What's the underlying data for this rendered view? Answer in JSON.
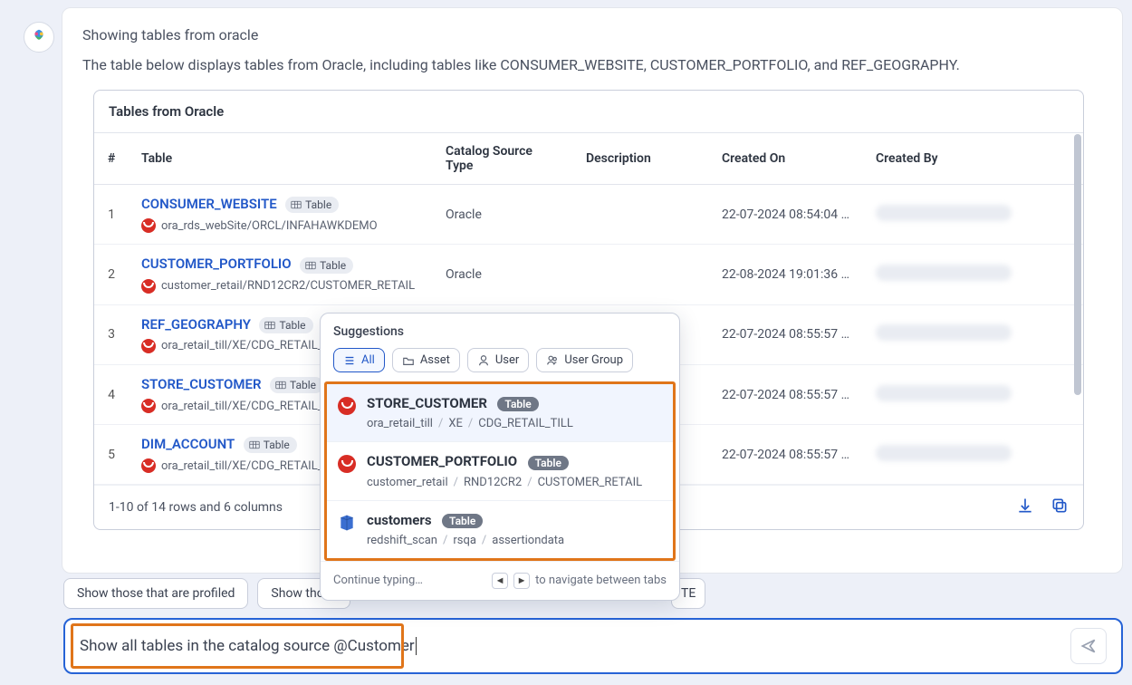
{
  "heading": "Showing tables from oracle",
  "subheading": "The table below displays tables from Oracle, including tables like CONSUMER_WEBSITE, CUSTOMER_PORTFOLIO, and REF_GEOGRAPHY.",
  "table": {
    "title": "Tables from Oracle",
    "columns": {
      "idx": "#",
      "table": "Table",
      "catalog": "Catalog Source Type",
      "desc": "Description",
      "created_on": "Created On",
      "created_by": "Created By"
    },
    "badge_label": "Table",
    "rows": [
      {
        "n": "1",
        "name": "CONSUMER_WEBSITE",
        "path": "ora_rds_webSite/ORCL/INFAHAWKDEMO",
        "catalog": "Oracle",
        "created_on": "22-07-2024 08:54:04 …"
      },
      {
        "n": "2",
        "name": "CUSTOMER_PORTFOLIO",
        "path": "customer_retail/RND12CR2/CUSTOMER_RETAIL",
        "catalog": "Oracle",
        "created_on": "22-08-2024 19:01:36 …"
      },
      {
        "n": "3",
        "name": "REF_GEOGRAPHY",
        "path": "ora_retail_till/XE/CDG_RETAIL_TI",
        "catalog": "",
        "created_on": "22-07-2024 08:55:57 …"
      },
      {
        "n": "4",
        "name": "STORE_CUSTOMER",
        "path": "ora_retail_till/XE/CDG_RETAIL_TI",
        "catalog": "",
        "created_on": "22-07-2024 08:55:57 …"
      },
      {
        "n": "5",
        "name": "DIM_ACCOUNT",
        "path": "ora_retail_till/XE/CDG_RETAIL_TI",
        "catalog": "",
        "created_on": "22-07-2024 08:55:57 …"
      }
    ],
    "footer": "1-10 of 14 rows and 6 columns"
  },
  "chips": {
    "a": "Show those that are profiled",
    "b_prefix": "Show those",
    "trailing": "TE"
  },
  "input": {
    "text": "Show all tables in the catalog source @Customer"
  },
  "suggestions": {
    "title": "Suggestions",
    "filters": {
      "all": "All",
      "asset": "Asset",
      "user": "User",
      "usergroup": "User Group"
    },
    "items": [
      {
        "title": "STORE_CUSTOMER",
        "badge": "Table",
        "path": [
          "ora_retail_till",
          "XE",
          "CDG_RETAIL_TILL"
        ],
        "source": "oracle"
      },
      {
        "title": "CUSTOMER_PORTFOLIO",
        "badge": "Table",
        "path": [
          "customer_retail",
          "RND12CR2",
          "CUSTOMER_RETAIL"
        ],
        "source": "oracle"
      },
      {
        "title": "customers",
        "badge": "Table",
        "path": [
          "redshift_scan",
          "rsqa",
          "assertiondata"
        ],
        "source": "redshift"
      }
    ],
    "footer": {
      "continue": "Continue typing…",
      "nav": "to navigate between tabs"
    }
  }
}
